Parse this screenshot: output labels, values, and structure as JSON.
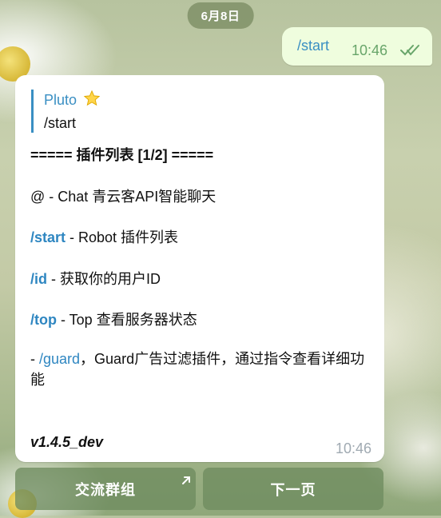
{
  "date_pill": "6月8日",
  "outgoing": {
    "text": "/start",
    "time": "10:46"
  },
  "message": {
    "reply_name": "Pluto",
    "reply_text": "/start",
    "title": "===== 插件列表 [1/2] =====",
    "lines": [
      {
        "cmd": "@",
        "desc": " - Chat 青云客API智能聊天"
      },
      {
        "cmd": "/start",
        "desc": " - Robot 插件列表"
      },
      {
        "cmd": "/id",
        "desc": " - 获取你的用户ID"
      },
      {
        "cmd": "/top",
        "desc": " - Top 查看服务器状态"
      }
    ],
    "guard_prefix": " - ",
    "guard_cmd": "/guard",
    "guard_desc": "，Guard广告过滤插件，通过指令查看详细功能",
    "version": "v1.4.5_dev",
    "time": "10:46"
  },
  "buttons": {
    "left": "交流群组",
    "right": "下一页"
  },
  "colors": {
    "link": "#2e86c1",
    "outgoing_bg": "#effdde",
    "button_bg": "#6e8c5f"
  }
}
